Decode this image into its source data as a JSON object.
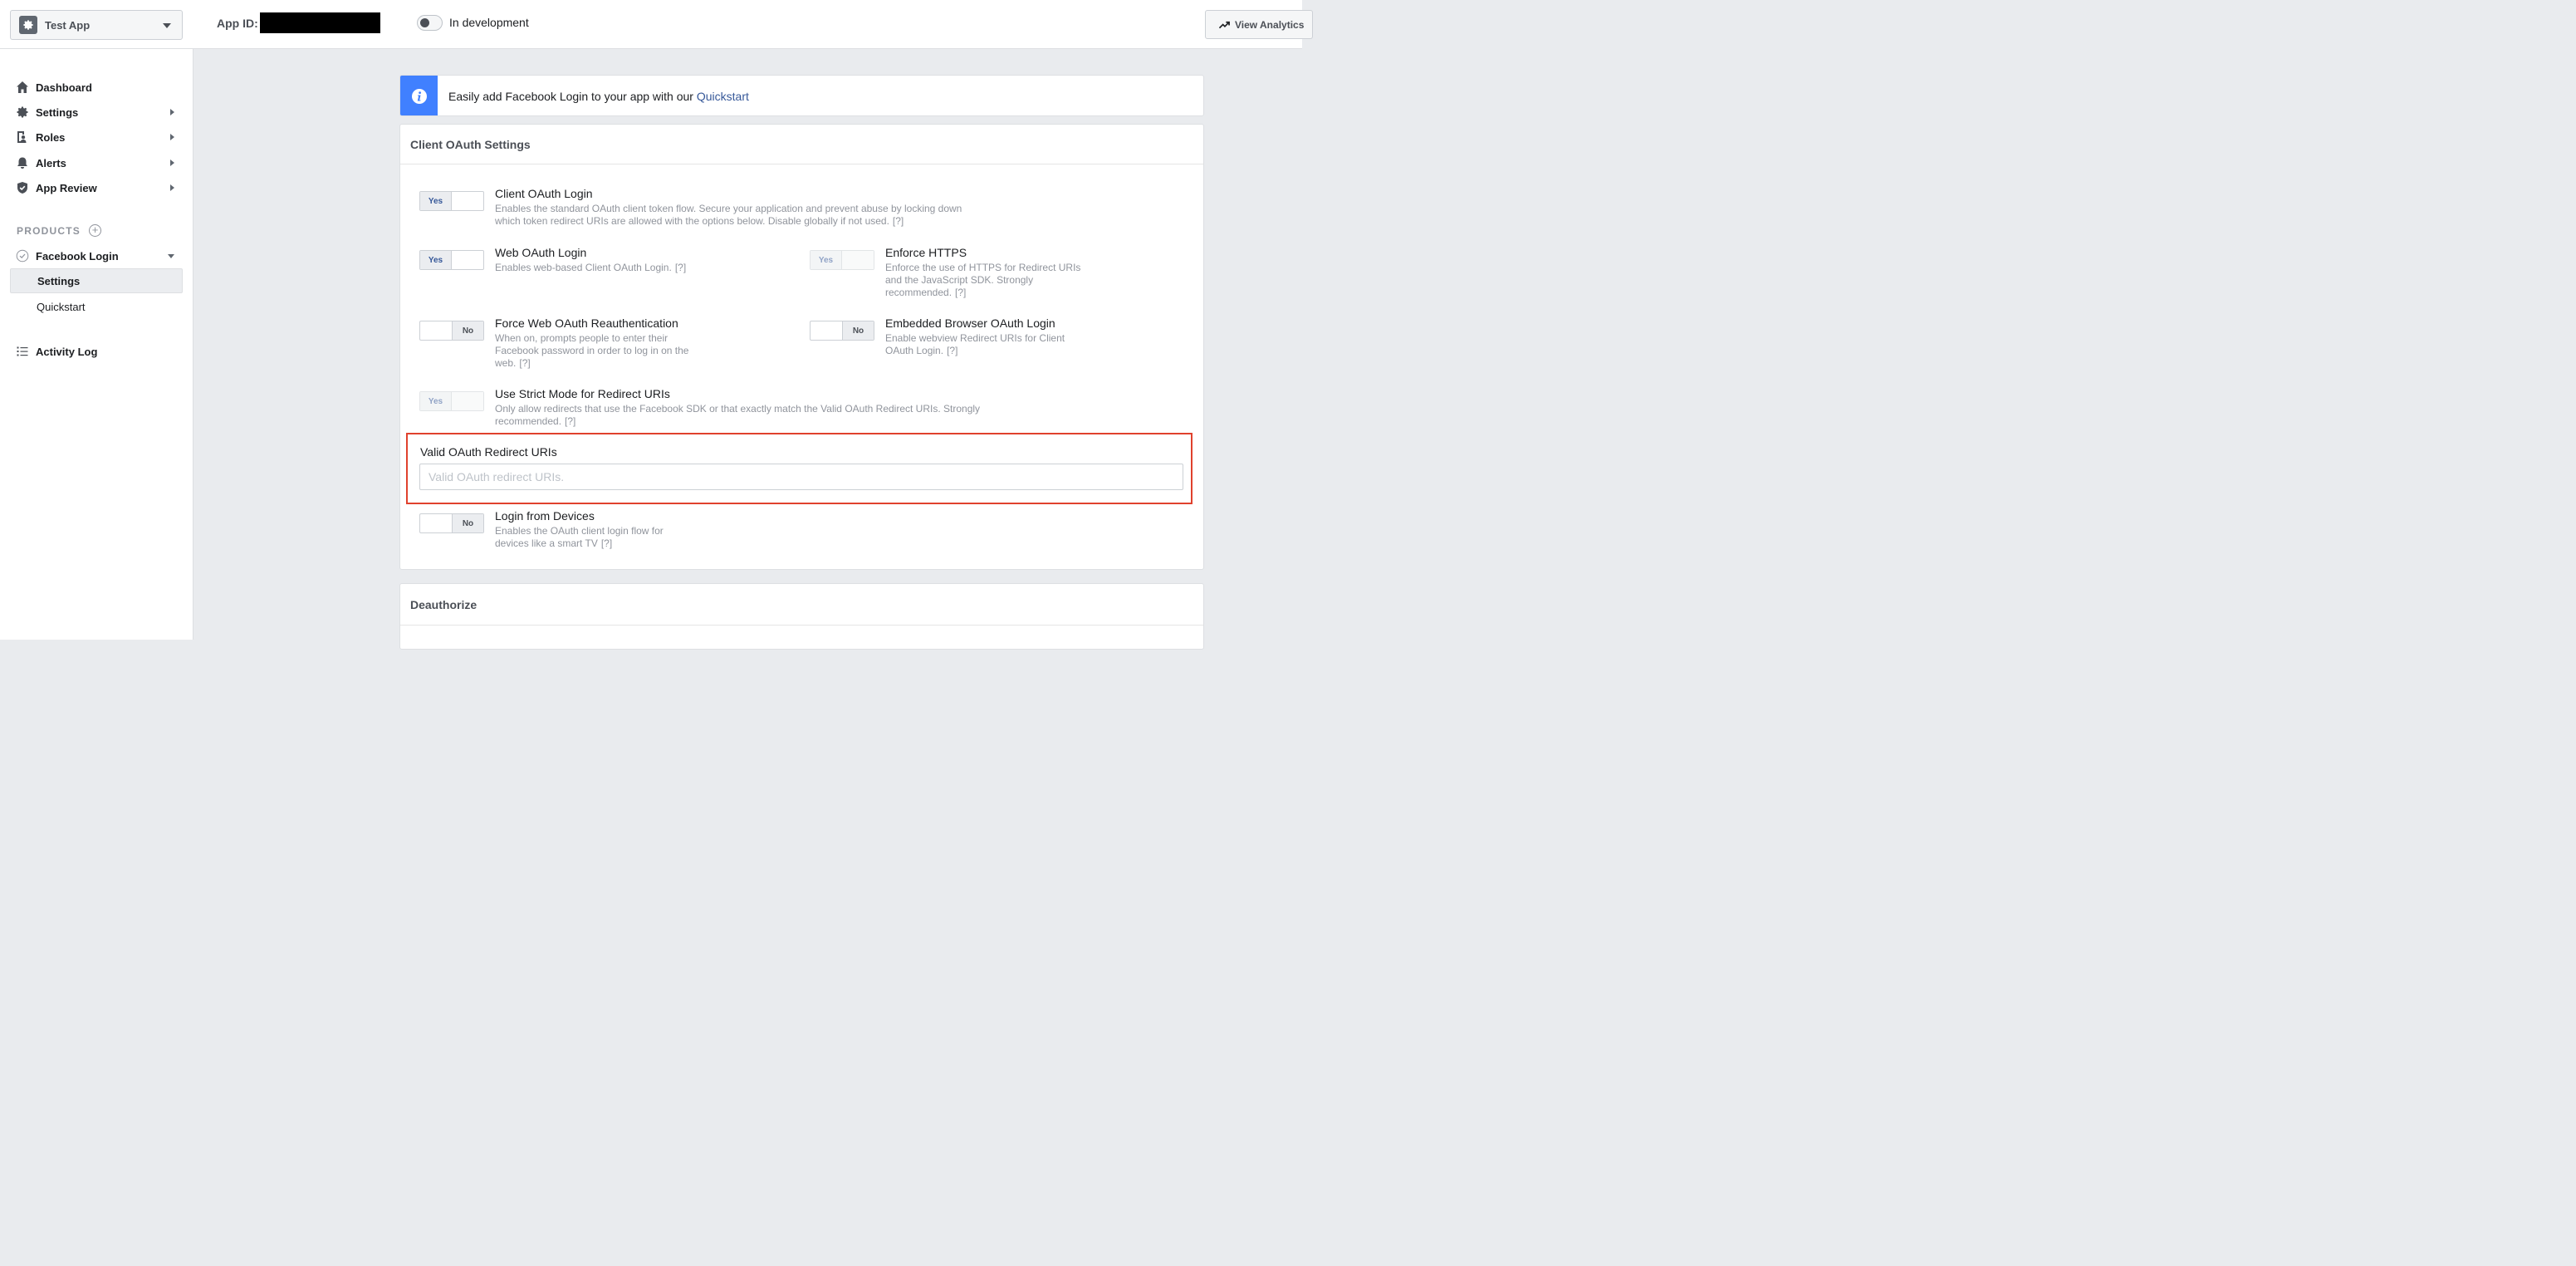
{
  "topbar": {
    "app_name": "Test App",
    "app_id_label": "App ID:",
    "dev_mode_label": "In development",
    "view_analytics_label": "View Analytics"
  },
  "sidebar": {
    "items": [
      {
        "label": "Dashboard"
      },
      {
        "label": "Settings"
      },
      {
        "label": "Roles"
      },
      {
        "label": "Alerts"
      },
      {
        "label": "App Review"
      }
    ],
    "products_label": "PRODUCTS",
    "product_name": "Facebook Login",
    "sub_items": [
      {
        "label": "Settings"
      },
      {
        "label": "Quickstart"
      }
    ],
    "activity_log": "Activity Log"
  },
  "banner": {
    "text": "Easily add Facebook Login to your app with our ",
    "link": "Quickstart"
  },
  "oauth": {
    "title": "Client OAuth Settings",
    "options": [
      {
        "title": "Client OAuth Login",
        "state": "Yes",
        "desc": "Enables the standard OAuth client token flow. Secure your application and prevent abuse by locking down which token redirect URIs are allowed with the options below. Disable globally if not used."
      },
      {
        "title": "Web OAuth Login",
        "state": "Yes",
        "desc": "Enables web-based Client OAuth Login."
      },
      {
        "title": "Enforce HTTPS",
        "state": "Yes",
        "desc": "Enforce the use of HTTPS for Redirect URIs and the JavaScript SDK. Strongly recommended."
      },
      {
        "title": "Force Web OAuth Reauthentication",
        "state": "No",
        "desc": "When on, prompts people to enter their Facebook password in order to log in on the web."
      },
      {
        "title": "Embedded Browser OAuth Login",
        "state": "No",
        "desc": "Enable webview Redirect URIs for Client OAuth Login."
      },
      {
        "title": "Use Strict Mode for Redirect URIs",
        "state": "Yes",
        "desc": "Only allow redirects that use the Facebook SDK or that exactly match the Valid OAuth Redirect URIs. Strongly recommended."
      },
      {
        "title": "Login from Devices",
        "state": "No",
        "desc": "Enables the OAuth client login flow for devices like a smart TV"
      }
    ],
    "help": "[?]",
    "redirect_label": "Valid OAuth Redirect URIs",
    "redirect_value": "",
    "redirect_placeholder": "Valid OAuth redirect URIs."
  },
  "deauthorize": {
    "title": "Deauthorize"
  }
}
